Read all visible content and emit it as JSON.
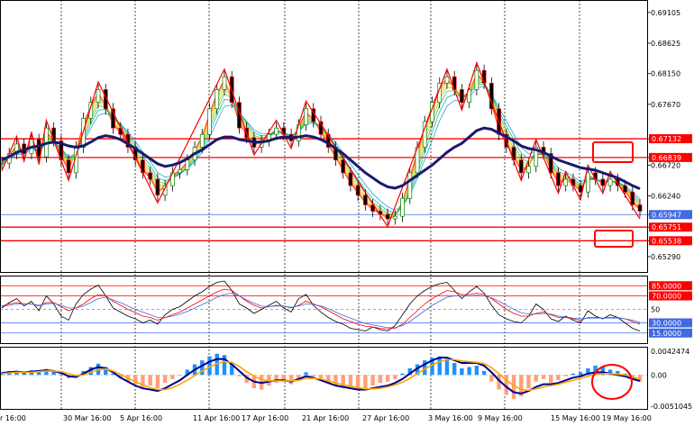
{
  "chart_data": [
    {
      "name": "main",
      "type": "line",
      "description_in_image": "candlesticks with moving average ribbon, zigzag, horizontal levels",
      "ylim": [
        0.6505,
        0.693
      ],
      "yticks": [
        0.69105,
        0.68625,
        0.6815,
        0.6767,
        0.67132,
        0.66839,
        0.6672,
        0.6624,
        0.65947,
        0.65751,
        0.65538,
        0.6529
      ],
      "ytick_labels": [
        "0.69105",
        "0.68625",
        "0.68150",
        "0.67670",
        "0.67132",
        "0.66839",
        "0.66720",
        "0.66240",
        "0.65947",
        "0.65751",
        "0.65538",
        "0.65290"
      ],
      "highlighted_tags": [
        "0.67132",
        "0.66839",
        "0.65947",
        "0.65751",
        "0.65538"
      ],
      "levels": [
        {
          "value": 0.67132,
          "color": "#ff0000"
        },
        {
          "value": 0.66839,
          "color": "#ff0000"
        },
        {
          "value": 0.65947,
          "color": "#4169e1"
        },
        {
          "value": 0.65751,
          "color": "#ff0000"
        },
        {
          "value": 0.65538,
          "color": "#ff0000"
        }
      ],
      "price": [
        0.6675,
        0.669,
        0.6705,
        0.669,
        0.6712,
        0.6685,
        0.673,
        0.671,
        0.668,
        0.666,
        0.67,
        0.6745,
        0.677,
        0.679,
        0.676,
        0.673,
        0.672,
        0.67,
        0.668,
        0.666,
        0.665,
        0.6625,
        0.664,
        0.666,
        0.6665,
        0.668,
        0.67,
        0.672,
        0.676,
        0.679,
        0.681,
        0.677,
        0.673,
        0.6715,
        0.67,
        0.671,
        0.672,
        0.673,
        0.672,
        0.671,
        0.6735,
        0.676,
        0.674,
        0.672,
        0.67,
        0.668,
        0.666,
        0.664,
        0.6625,
        0.661,
        0.66,
        0.6595,
        0.6588,
        0.6592,
        0.662,
        0.666,
        0.67,
        0.674,
        0.677,
        0.68,
        0.681,
        0.679,
        0.677,
        0.679,
        0.682,
        0.68,
        0.676,
        0.672,
        0.67,
        0.668,
        0.666,
        0.667,
        0.67,
        0.669,
        0.666,
        0.664,
        0.665,
        0.664,
        0.663,
        0.666,
        0.665,
        0.664,
        0.665,
        0.664,
        0.663,
        0.661,
        0.66
      ],
      "ma": [
        0.668,
        0.6685,
        0.6692,
        0.6696,
        0.67,
        0.6702,
        0.6706,
        0.6708,
        0.6706,
        0.6702,
        0.67,
        0.6702,
        0.6708,
        0.6715,
        0.6718,
        0.6716,
        0.6712,
        0.6705,
        0.6698,
        0.669,
        0.6682,
        0.6674,
        0.667,
        0.6672,
        0.6676,
        0.6682,
        0.669,
        0.6696,
        0.6704,
        0.6712,
        0.6716,
        0.6716,
        0.6712,
        0.671,
        0.6708,
        0.6708,
        0.671,
        0.6714,
        0.6716,
        0.6715,
        0.6716,
        0.6718,
        0.6716,
        0.6712,
        0.6706,
        0.6698,
        0.669,
        0.668,
        0.667,
        0.666,
        0.6652,
        0.6644,
        0.6638,
        0.6636,
        0.664,
        0.6648,
        0.6656,
        0.6664,
        0.6672,
        0.6682,
        0.6692,
        0.67,
        0.6706,
        0.6716,
        0.6726,
        0.673,
        0.6728,
        0.6722,
        0.6716,
        0.671,
        0.6702,
        0.6698,
        0.6696,
        0.6692,
        0.6686,
        0.668,
        0.6676,
        0.6672,
        0.6668,
        0.6666,
        0.6664,
        0.666,
        0.6656,
        0.6652,
        0.6646,
        0.664,
        0.6635
      ]
    },
    {
      "name": "oscillator",
      "type": "line",
      "ylim": [
        0,
        100
      ],
      "ytick_labels": [
        "85.0000",
        "70.0000",
        "50",
        "30.0000",
        "15.0000"
      ],
      "levels": [
        85,
        70,
        50,
        30,
        15
      ],
      "series": [
        {
          "color": "#000000",
          "values": [
            52,
            60,
            66,
            55,
            62,
            48,
            70,
            58,
            40,
            34,
            58,
            72,
            80,
            86,
            70,
            52,
            46,
            40,
            36,
            30,
            34,
            28,
            42,
            50,
            54,
            62,
            70,
            76,
            84,
            90,
            92,
            78,
            58,
            52,
            44,
            50,
            56,
            62,
            52,
            46,
            66,
            72,
            56,
            46,
            38,
            32,
            28,
            22,
            20,
            18,
            24,
            20,
            18,
            26,
            42,
            58,
            70,
            78,
            84,
            88,
            90,
            78,
            66,
            76,
            84,
            74,
            56,
            42,
            36,
            32,
            30,
            40,
            58,
            50,
            36,
            32,
            40,
            34,
            30,
            48,
            40,
            36,
            42,
            38,
            30,
            22,
            18
          ]
        },
        {
          "color": "#ff0000",
          "values": [
            55,
            58,
            60,
            58,
            58,
            55,
            60,
            60,
            54,
            48,
            52,
            58,
            66,
            72,
            70,
            62,
            56,
            50,
            45,
            40,
            38,
            34,
            38,
            42,
            46,
            52,
            58,
            64,
            70,
            76,
            80,
            78,
            70,
            62,
            56,
            52,
            54,
            56,
            55,
            52,
            56,
            62,
            58,
            54,
            48,
            42,
            36,
            32,
            28,
            25,
            24,
            22,
            21,
            22,
            28,
            38,
            48,
            58,
            66,
            72,
            78,
            76,
            72,
            72,
            74,
            72,
            66,
            58,
            50,
            44,
            40,
            40,
            44,
            46,
            42,
            38,
            38,
            36,
            34,
            38,
            38,
            37,
            38,
            38,
            36,
            32,
            28
          ]
        },
        {
          "color": "#4169e1",
          "values": [
            54,
            56,
            58,
            58,
            58,
            56,
            58,
            59,
            56,
            52,
            52,
            55,
            60,
            66,
            68,
            64,
            60,
            55,
            50,
            46,
            42,
            38,
            38,
            40,
            43,
            47,
            52,
            57,
            62,
            68,
            72,
            74,
            70,
            64,
            59,
            55,
            54,
            55,
            55,
            53,
            55,
            58,
            57,
            55,
            51,
            46,
            41,
            37,
            33,
            29,
            27,
            25,
            23,
            23,
            26,
            32,
            40,
            48,
            56,
            62,
            68,
            70,
            70,
            70,
            71,
            70,
            67,
            62,
            56,
            50,
            45,
            43,
            43,
            44,
            43,
            40,
            39,
            37,
            36,
            37,
            37,
            37,
            37,
            37,
            36,
            34,
            31
          ]
        }
      ]
    },
    {
      "name": "macd",
      "type": "bar",
      "ylim": [
        -0.0051045,
        0.0042474
      ],
      "ytick_labels": [
        "0.0042474",
        "0.00",
        "-0.0051045"
      ],
      "histogram": [
        0.0004,
        0.0006,
        0.0005,
        0.0003,
        0.0007,
        0.0004,
        0.0009,
        0.0006,
        0.0001,
        -0.0005,
        -0.0002,
        0.0006,
        0.0012,
        0.0017,
        0.0012,
        0.0002,
        -0.0005,
        -0.001,
        -0.0014,
        -0.0018,
        -0.0016,
        -0.002,
        -0.0012,
        -0.0006,
        -0.0001,
        0.0008,
        0.0016,
        0.0022,
        0.0028,
        0.0032,
        0.003,
        0.0016,
        -0.0002,
        -0.0012,
        -0.002,
        -0.0022,
        -0.0016,
        -0.0012,
        -0.001,
        -0.0014,
        -0.0006,
        0.0004,
        -0.0002,
        -0.0008,
        -0.0012,
        -0.0016,
        -0.002,
        -0.0018,
        -0.0022,
        -0.002,
        -0.0016,
        -0.0012,
        -0.001,
        -0.0006,
        0.0002,
        0.001,
        0.0016,
        0.0022,
        0.0026,
        0.0028,
        0.0024,
        0.0018,
        0.001,
        0.0012,
        0.0014,
        0.0006,
        -0.001,
        -0.0022,
        -0.003,
        -0.0036,
        -0.0032,
        -0.002,
        -0.001,
        -0.0006,
        -0.0012,
        -0.0008,
        -0.0002,
        0.0002,
        0.0004,
        0.001,
        0.0014,
        0.0012,
        0.0008,
        0.0006,
        0.0002,
        -0.0006,
        -0.001
      ],
      "series": [
        {
          "color": "#00008b",
          "values": [
            0.0003,
            0.0004,
            0.0005,
            0.0004,
            0.0005,
            0.0006,
            0.0007,
            0.0006,
            0.0003,
            -0.0002,
            -0.0003,
            0.0002,
            0.0008,
            0.0012,
            0.001,
            0.0004,
            -0.0004,
            -0.001,
            -0.0016,
            -0.002,
            -0.0022,
            -0.0024,
            -0.002,
            -0.0014,
            -0.0008,
            0.0,
            0.0008,
            0.0014,
            0.002,
            0.0024,
            0.0024,
            0.0016,
            0.0006,
            -0.0004,
            -0.001,
            -0.0012,
            -0.001,
            -0.0008,
            -0.0008,
            -0.001,
            -0.0006,
            -0.0002,
            -0.0004,
            -0.0008,
            -0.0012,
            -0.0016,
            -0.0018,
            -0.002,
            -0.0022,
            -0.0022,
            -0.002,
            -0.0018,
            -0.0016,
            -0.0012,
            -0.0006,
            0.0002,
            0.001,
            0.0016,
            0.0022,
            0.0026,
            0.0026,
            0.0022,
            0.0018,
            0.0018,
            0.0018,
            0.0014,
            0.0004,
            -0.0008,
            -0.0018,
            -0.0026,
            -0.0028,
            -0.0024,
            -0.0018,
            -0.0014,
            -0.0014,
            -0.0012,
            -0.0008,
            -0.0004,
            -0.0002,
            0.0002,
            0.0004,
            0.0004,
            0.0002,
            0.0,
            -0.0002,
            -0.0006,
            -0.0009
          ]
        },
        {
          "color": "#ffa500",
          "values": [
            0.0002,
            0.0003,
            0.0004,
            0.0004,
            0.0004,
            0.0005,
            0.0006,
            0.0006,
            0.0005,
            0.0002,
            -0.0001,
            0.0,
            0.0004,
            0.0008,
            0.0009,
            0.0006,
            0.0001,
            -0.0005,
            -0.001,
            -0.0015,
            -0.0019,
            -0.0022,
            -0.0022,
            -0.0019,
            -0.0014,
            -0.0008,
            -0.0001,
            0.0006,
            0.0012,
            0.0017,
            0.002,
            0.0019,
            0.0013,
            0.0005,
            -0.0002,
            -0.0007,
            -0.0009,
            -0.0009,
            -0.0009,
            -0.0009,
            -0.0008,
            -0.0005,
            -0.0005,
            -0.0006,
            -0.0009,
            -0.0012,
            -0.0015,
            -0.0017,
            -0.0019,
            -0.0021,
            -0.0021,
            -0.002,
            -0.0018,
            -0.0015,
            -0.0011,
            -0.0005,
            0.0002,
            0.0009,
            0.0015,
            0.002,
            0.0023,
            0.0023,
            0.0021,
            0.002,
            0.0019,
            0.0017,
            0.0011,
            0.0002,
            -0.0008,
            -0.0016,
            -0.0022,
            -0.0023,
            -0.0021,
            -0.0018,
            -0.0016,
            -0.0014,
            -0.0011,
            -0.0008,
            -0.0005,
            -0.0002,
            0.0001,
            0.0002,
            0.0002,
            0.0001,
            0.0,
            -0.0003,
            -0.0006
          ]
        }
      ]
    }
  ],
  "xaxis": {
    "labels": [
      "r 16:00",
      "30 Mar 16:00",
      "5 Apr 16:00",
      "11 Apr 16:00",
      "17 Apr 16:00",
      "21 Apr 16:00",
      "27 Apr 16:00",
      "3 May 16:00",
      "9 May 16:00",
      "15 May 16:00",
      "19 May 16:00"
    ]
  },
  "colors": {
    "level_tag_red": "#ff0000",
    "level_tag_blue": "#4169e1",
    "bullish": "#008000",
    "bearish": "#ff0000",
    "zigzag": "#ff0000",
    "ma": "#191970",
    "hist_pos": "#1e90ff",
    "hist_neg": "#ffa07a",
    "annotation": "#ff0000"
  }
}
